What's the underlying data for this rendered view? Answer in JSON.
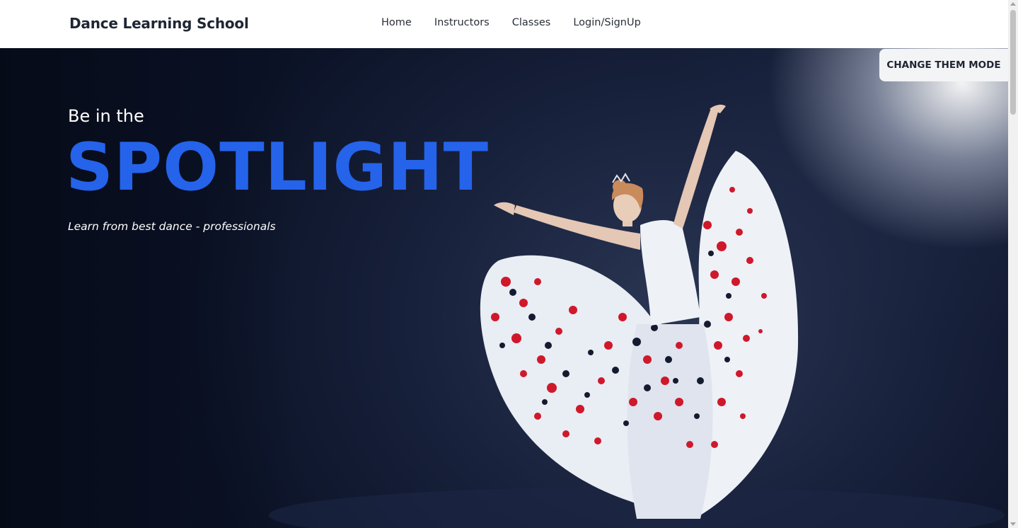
{
  "navbar": {
    "brand": "Dance Learning School",
    "links": [
      {
        "label": "Home"
      },
      {
        "label": "Instructors"
      },
      {
        "label": "Classes"
      },
      {
        "label": "Login/SignUp"
      }
    ]
  },
  "hero": {
    "subtitle": "Be in the",
    "title": "SPOTLIGHT",
    "tagline": "Learn from best dance - professionals",
    "image_alt": "dancer-in-white-and-red-floral-skirt"
  },
  "theme_toggle": {
    "label": "CHANGE THEM MODE"
  },
  "colors": {
    "accent": "#2563eb",
    "navbar_bg": "#ffffff",
    "hero_bg": "#0b1226",
    "button_bg": "#f3f4f6"
  }
}
